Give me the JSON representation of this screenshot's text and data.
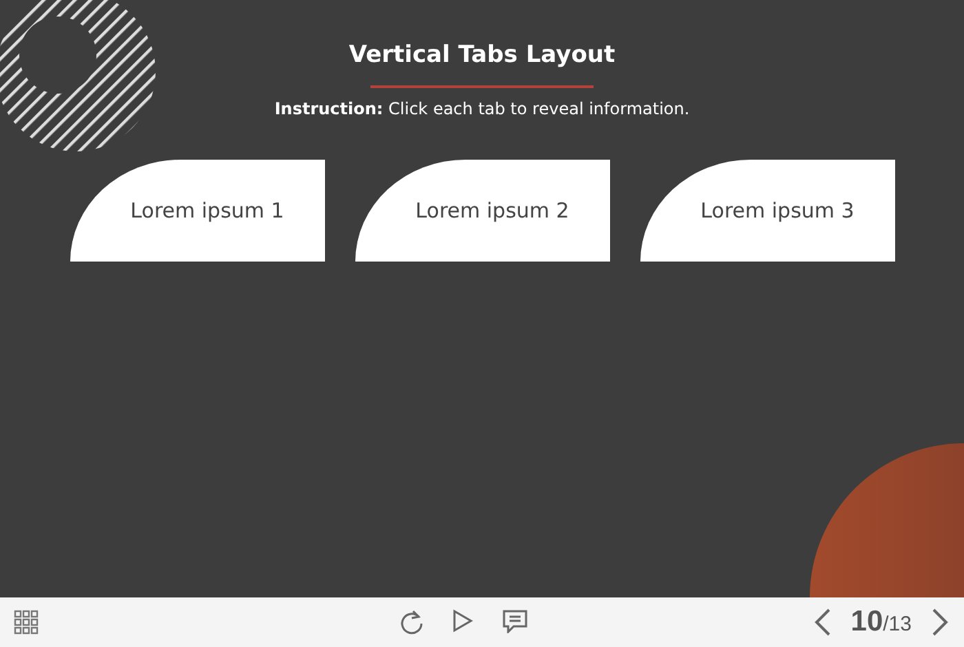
{
  "slide": {
    "title": "Vertical Tabs Layout",
    "instruction": "**Instruction:** Click each tab to reveal information.",
    "tabs": [
      {
        "label": "Lorem ipsum 1"
      },
      {
        "label": "Lorem ipsum 2"
      },
      {
        "label": "Lorem ipsum 3"
      }
    ]
  },
  "player": {
    "page_current": "10",
    "page_total": "/13"
  }
}
